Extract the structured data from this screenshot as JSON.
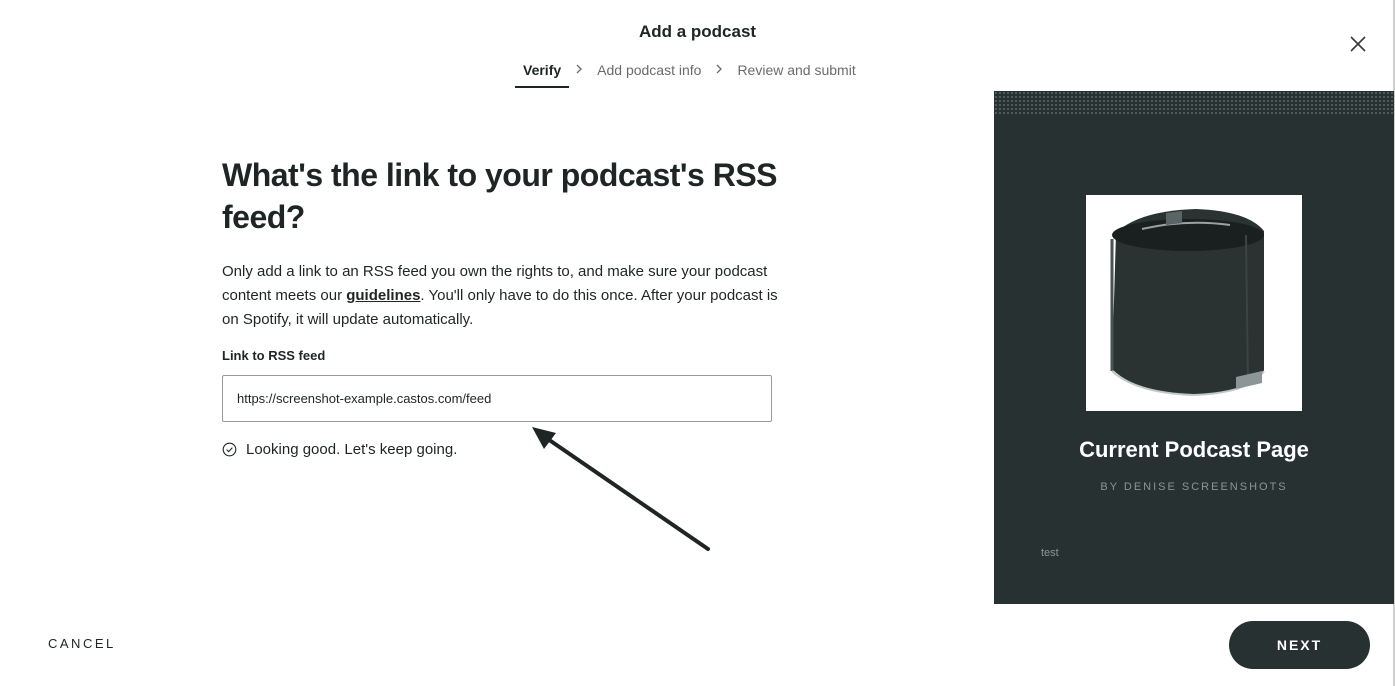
{
  "modal": {
    "title": "Add a podcast",
    "close_icon": "close-icon"
  },
  "stepper": {
    "steps": [
      {
        "label": "Verify",
        "active": true
      },
      {
        "label": "Add podcast info",
        "active": false
      },
      {
        "label": "Review and submit",
        "active": false
      }
    ],
    "separator_icon": "chevron-right-icon"
  },
  "form": {
    "heading": "What's the link to your podcast's RSS feed?",
    "description_before": "Only add a link to an RSS feed you own the rights to, and make sure your podcast content meets our ",
    "guidelines_link": "guidelines",
    "description_after": ". You'll only have to do this once. After your podcast is on Spotify, it will update automatically.",
    "field_label": "Link to RSS feed",
    "rss_value": "https://screenshot-example.castos.com/feed",
    "status_text": "Looking good. Let's keep going.",
    "status_icon": "check-circle-icon"
  },
  "preview": {
    "podcast_title": "Current Podcast Page",
    "author": "BY DENISE SCREENSHOTS",
    "description": "test",
    "cover_icon": "podcast-cover-image"
  },
  "footer": {
    "cancel_label": "CANCEL",
    "next_label": "NEXT"
  },
  "colors": {
    "primary_dark": "#283131",
    "text": "#1f2424",
    "muted": "#6b6b6b"
  }
}
